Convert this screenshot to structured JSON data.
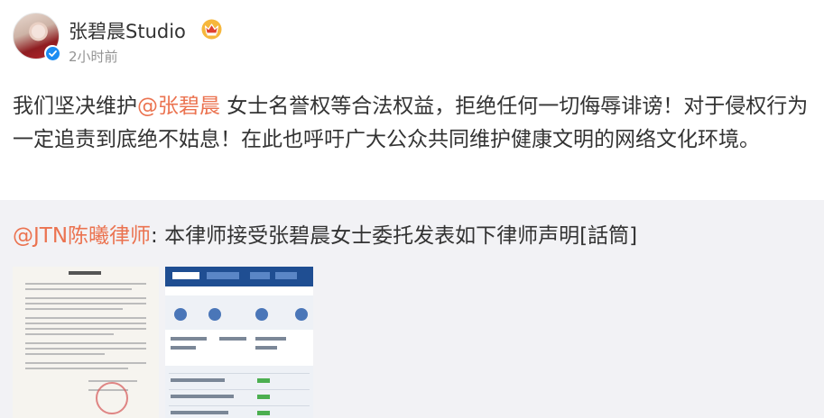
{
  "header": {
    "username": "张碧晨Studio",
    "timestamp": "2小时前",
    "crown_icon": "crown-badge-icon",
    "verified_icon": "verified-check-icon"
  },
  "post": {
    "text_before": "我们坚决维护",
    "mention": "@张碧晨",
    "text_after": " 女士名誉权等合法权益，拒绝任何一切侮辱诽谤！对于侵权行为一定追责到底绝不姑息！在此也呼吁广大公众共同维护健康文明的网络文化环境。"
  },
  "repost": {
    "author": "@JTN陈曦律师",
    "separator": ": ",
    "text": "本律师接受张碧晨女士委托发表如下律师声明[話筒]",
    "images": [
      {
        "name": "lawyer-statement-document"
      },
      {
        "name": "court-website-screenshot"
      }
    ]
  },
  "colors": {
    "link": "#eb7350",
    "text": "#333333",
    "muted": "#939393",
    "repost_bg": "#f2f2f5",
    "verified": "#1b8cf2"
  }
}
